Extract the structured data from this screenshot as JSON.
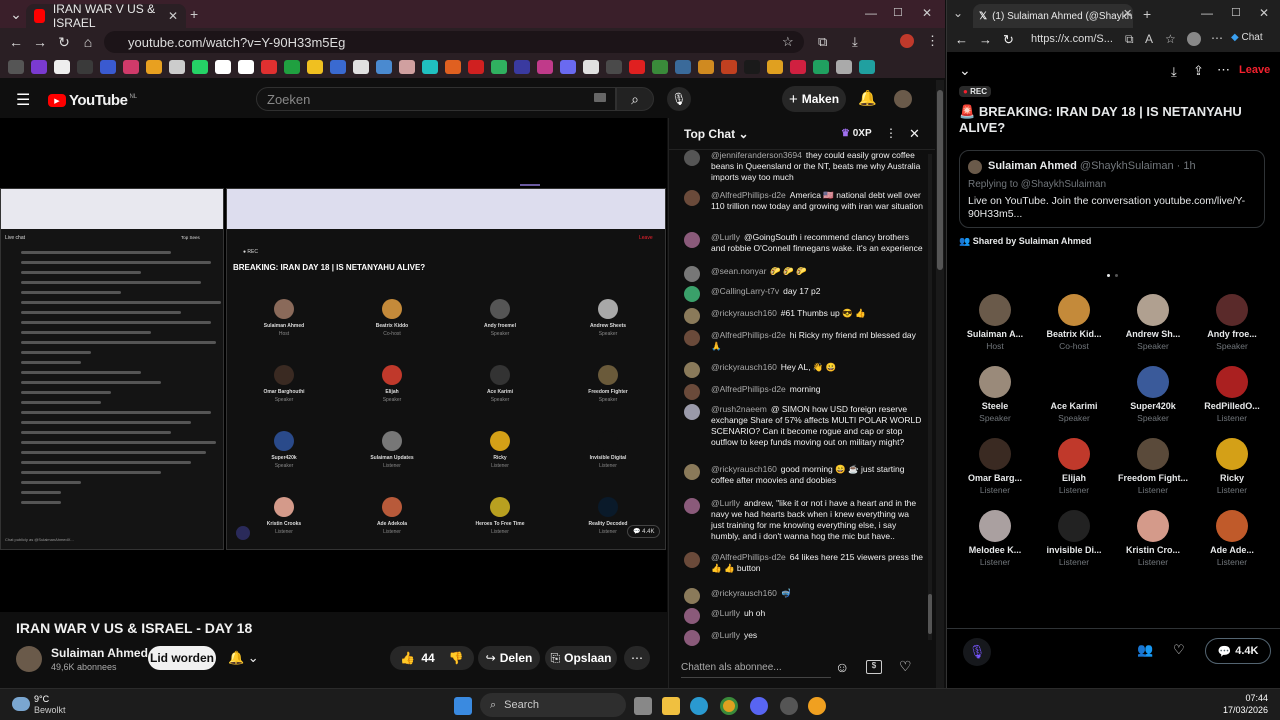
{
  "left_browser": {
    "tab_title": "IRAN WAR V US & ISRAEL",
    "url": "youtube.com/watch?v=Y-90H33m5Eg"
  },
  "youtube": {
    "logo_text": "YouTube",
    "logo_region": "NL",
    "search_placeholder": "Zoeken",
    "create_label": "Maken",
    "video_title": "IRAN WAR V US & ISRAEL - DAY 18",
    "channel_name": "Sulaiman Ahmed",
    "subscribers": "49,6K abonnees",
    "join_label": "Lid worden",
    "likes": "44",
    "share_label": "Delen",
    "save_label": "Opslaan"
  },
  "video_overlay": {
    "breaking_title": "BREAKING: IRAN DAY 18 | IS NETANYAHU ALIVE?",
    "rec_label": "REC",
    "leave_label": "Leave",
    "live_chat_label": "Live chat",
    "top_sort": "Top Sees",
    "count": "4.4K",
    "chat_input_placeholder": "Chat publicly as @SulaimanAhmedX...",
    "speakers": [
      {
        "name": "Sulaiman Ahmed",
        "role": "Host",
        "color": "#8a6a5a"
      },
      {
        "name": "Beatrix Kiddo",
        "role": "Co-host",
        "color": "#c48a3a"
      },
      {
        "name": "Andy froemel",
        "role": "Speaker",
        "color": "#555"
      },
      {
        "name": "Andrew Sheets",
        "role": "Speaker",
        "color": "#a8a8a8"
      },
      {
        "name": "Omar Barghouthi",
        "role": "Speaker",
        "color": "#3a2a22"
      },
      {
        "name": "Elijah",
        "role": "Speaker",
        "color": "#c0392b"
      },
      {
        "name": "Ace Karimi",
        "role": "Speaker",
        "color": "#333"
      },
      {
        "name": "Freedom Fighter",
        "role": "Speaker",
        "color": "#6a5a3a"
      },
      {
        "name": "Super420k",
        "role": "Speaker",
        "color": "#2a4a8a"
      },
      {
        "name": "Sulaiman Updates",
        "role": "Listener",
        "color": "#777"
      },
      {
        "name": "Ricky",
        "role": "Listener",
        "color": "#d4a017"
      },
      {
        "name": "Invisible Digital",
        "role": "Listener",
        "color": "#111"
      },
      {
        "name": "Kristin Crooks",
        "role": "Listener",
        "color": "#d49a8a"
      },
      {
        "name": "Ade Adekola",
        "role": "Listener",
        "color": "#b85a3a"
      },
      {
        "name": "Heroes To Free Time",
        "role": "Listener",
        "color": "#b8a020"
      },
      {
        "name": "Reality Decoded",
        "role": "Listener",
        "color": "#0a1a2a"
      }
    ]
  },
  "chat": {
    "header": "Top Chat",
    "xp": "0XP",
    "input_placeholder": "Chatten als abonnee...",
    "messages": [
      {
        "author": "@jenniferanderson3694",
        "text": "they could easily grow coffee beans in Queensland or the NT, beats me why Australia imports way too much",
        "color": "#555"
      },
      {
        "author": "@AlfredPhillips-d2e",
        "text": "America 🇺🇸 national debt well over 110 trillion now today and growing with iran war situation",
        "color": "#6a4a3a"
      },
      {
        "author": "@Lurlly",
        "text": "@GoingSouth i recommend clancy brothers and robbie O'Connell finnegans wake. it's an experience",
        "color": "#8a5a7a"
      },
      {
        "author": "@sean.nonyar",
        "text": "🌮 🌮 🌮",
        "color": "#777"
      },
      {
        "author": "@CallingLarry-t7v",
        "text": "day 17 p2",
        "color": "#3aa06a"
      },
      {
        "author": "@rickyrausch160",
        "text": "#61 Thumbs up 😎 👍",
        "color": "#8a7a5a"
      },
      {
        "author": "@AlfredPhillips-d2e",
        "text": "hi Ricky my friend ml blessed day 🙏",
        "color": "#6a4a3a"
      },
      {
        "author": "@rickyrausch160",
        "text": "Hey AL, 👋 😀",
        "color": "#8a7a5a"
      },
      {
        "author": "@AlfredPhillips-d2e",
        "text": "morning",
        "color": "#6a4a3a"
      },
      {
        "author": "@rush2naeem",
        "text": "@ SIMON how USD foreign reserve exchange Share of 57% affects MULTI POLAR WORLD SCENARIO? Can it become rogue and cap or stop outflow to keep funds moving out on military might?",
        "color": "#9a9aaa"
      },
      {
        "author": "@rickyrausch160",
        "text": "good morning 😄 ☕ just starting coffee after moovies and doobies",
        "color": "#8a7a5a"
      },
      {
        "author": "@Lurlly",
        "text": "andrew, \"like it or not i have a heart and in the navy we had hearts back when i knew everything wa just training for me knowing everything else, i say humbly, and i don't wanna hog the mic but have..",
        "color": "#8a5a7a"
      },
      {
        "author": "@AlfredPhillips-d2e",
        "text": "64 likes here 215 viewers press the 👍 👍 button",
        "color": "#6a4a3a"
      },
      {
        "author": "@rickyrausch160",
        "text": "🤿",
        "color": "#8a7a5a"
      },
      {
        "author": "@Lurlly",
        "text": "uh oh",
        "color": "#8a5a7a"
      },
      {
        "author": "@Lurlly",
        "text": "yes",
        "color": "#8a5a7a"
      }
    ]
  },
  "right_browser": {
    "tab_title": "(1) Sulaiman Ahmed (@ShaykhSul...",
    "url": "https://x.com/S...",
    "chat_label": "Chat",
    "leave_label": "Leave",
    "rec_label": "REC",
    "space_title": "BREAKING: IRAN DAY 18 | IS NETANYAHU ALIVE?",
    "post_author": "Sulaiman Ahmed",
    "post_handle": "@ShaykhSulaiman · 1h",
    "replying_to": "Replying to @ShaykhSulaiman",
    "post_text": "Live on YouTube. Join the conversation youtube.com/live/Y-90H33m5...",
    "shared_by": "Shared by Sulaiman Ahmed",
    "count": "4.4K",
    "speakers": [
      {
        "name": "Sulaiman A...",
        "role": "Host",
        "color": "#6a5a4a"
      },
      {
        "name": "Beatrix Kid...",
        "role": "Co-host",
        "color": "#c48a3a"
      },
      {
        "name": "Andrew Sh...",
        "role": "Speaker",
        "color": "#b0a090"
      },
      {
        "name": "Andy froe...",
        "role": "Speaker",
        "color": "#5a2a2a"
      },
      {
        "name": "Steele",
        "role": "Speaker",
        "color": "#9a8a7a"
      },
      {
        "name": "Ace Karimi",
        "role": "Speaker",
        "color": "#000"
      },
      {
        "name": "Super420k",
        "role": "Speaker",
        "color": "#3a5a9a"
      },
      {
        "name": "RedPilledO...",
        "role": "Listener",
        "color": "#aa2020"
      },
      {
        "name": "Omar Barg...",
        "role": "Listener",
        "color": "#3a2a22"
      },
      {
        "name": "Elijah",
        "role": "Listener",
        "color": "#c0392b"
      },
      {
        "name": "Freedom Fight...",
        "role": "Listener",
        "color": "#5a4a3a"
      },
      {
        "name": "Ricky",
        "role": "Listener",
        "color": "#d4a017"
      },
      {
        "name": "Melodee K...",
        "role": "Listener",
        "color": "#aaa0a0"
      },
      {
        "name": "invisible Di...",
        "role": "Listener",
        "color": "#222"
      },
      {
        "name": "Kristin Cro...",
        "role": "Listener",
        "color": "#d49a8a"
      },
      {
        "name": "Ade Ade...",
        "role": "Listener",
        "color": "#c05a2a"
      }
    ]
  },
  "taskbar": {
    "temp": "9°C",
    "weather": "Bewolkt",
    "search_label": "Search",
    "time": "07:44",
    "date": "17/03/2026"
  }
}
